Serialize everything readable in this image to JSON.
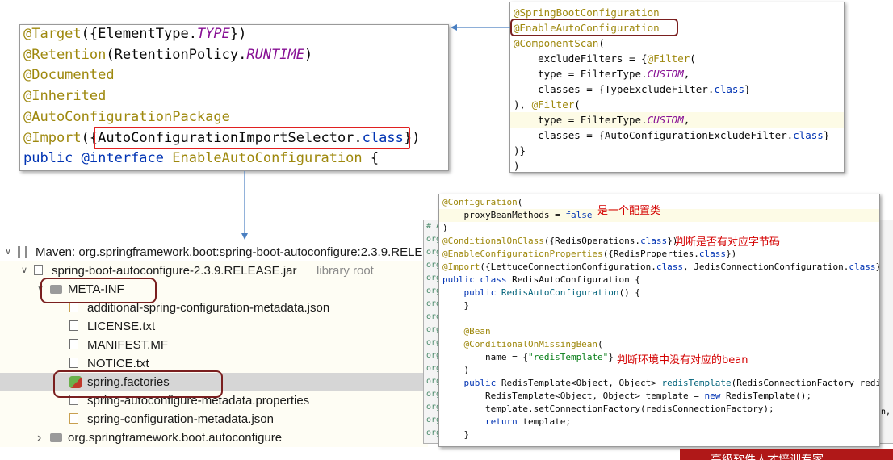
{
  "panel1": {
    "lines": [
      [
        {
          "t": "@Target",
          "c": "ann"
        },
        {
          "t": "({ElementType.",
          "c": "plain"
        },
        {
          "t": "TYPE",
          "c": "it"
        },
        {
          "t": "})",
          "c": "plain"
        }
      ],
      [
        {
          "t": "@Retention",
          "c": "ann"
        },
        {
          "t": "(RetentionPolicy.",
          "c": "plain"
        },
        {
          "t": "RUNTIME",
          "c": "it"
        },
        {
          "t": ")",
          "c": "plain"
        }
      ],
      [
        {
          "t": "@Documented",
          "c": "ann"
        }
      ],
      [
        {
          "t": "@Inherited",
          "c": "ann"
        }
      ],
      [
        {
          "t": "@AutoConfigurationPackage",
          "c": "ann"
        }
      ],
      [
        {
          "t": "@Import",
          "c": "ann"
        },
        {
          "t": "({",
          "c": "plain"
        },
        {
          "t": "AutoConfigurationImportSelector.",
          "c": "plain"
        },
        {
          "t": "class",
          "c": "kw"
        },
        {
          "t": "})",
          "c": "plain"
        }
      ],
      [
        {
          "t": "public ",
          "c": "kw"
        },
        {
          "t": "@interface ",
          "c": "kw"
        },
        {
          "t": "EnableAutoConfiguration",
          "c": "ann"
        },
        {
          "t": " {",
          "c": "plain"
        }
      ]
    ]
  },
  "panel2": {
    "lines": [
      [
        {
          "t": "@SpringBootConfiguration",
          "c": "ann"
        }
      ],
      [
        {
          "t": "@EnableAutoConfiguration",
          "c": "ann"
        }
      ],
      [
        {
          "t": "@ComponentScan",
          "c": "ann"
        },
        {
          "t": "(",
          "c": "plain"
        }
      ],
      [
        {
          "t": "    excludeFilters = {",
          "c": "plain"
        },
        {
          "t": "@Filter",
          "c": "ann"
        },
        {
          "t": "(",
          "c": "plain"
        }
      ],
      [
        {
          "t": "    type = FilterType.",
          "c": "plain"
        },
        {
          "t": "CUSTOM",
          "c": "it"
        },
        {
          "t": ",",
          "c": "plain"
        }
      ],
      [
        {
          "t": "    classes = {TypeExcludeFilter.",
          "c": "plain"
        },
        {
          "t": "class",
          "c": "kw"
        },
        {
          "t": "}",
          "c": "plain"
        }
      ],
      [
        {
          "t": "), ",
          "c": "plain"
        },
        {
          "t": "@Filter",
          "c": "ann"
        },
        {
          "t": "(",
          "c": "plain"
        }
      ],
      [
        {
          "t": "    type = FilterType.",
          "c": "plain"
        },
        {
          "t": "CUSTOM",
          "c": "it"
        },
        {
          "t": ",",
          "c": "plain"
        }
      ],
      [
        {
          "t": "    classes = {AutoConfigurationExcludeFilter.",
          "c": "plain"
        },
        {
          "t": "class",
          "c": "kw"
        },
        {
          "t": "}",
          "c": "plain"
        }
      ],
      [
        {
          "t": ")}",
          "c": "plain"
        }
      ],
      [
        {
          "t": ")",
          "c": "plain"
        }
      ]
    ]
  },
  "tree": {
    "rows": [
      {
        "text": "Maven: org.springframework.boot:spring-boot-autoconfigure:2.3.9.RELE",
        "suffix": "",
        "icon": "library-icon",
        "chevron": "open"
      },
      {
        "text": "spring-boot-autoconfigure-2.3.9.RELEASE.jar",
        "suffix": "library root",
        "icon": "jar-icon",
        "chevron": "open"
      },
      {
        "text": "META-INF",
        "suffix": "",
        "icon": "folder-icon",
        "chevron": "open"
      },
      {
        "text": "additional-spring-configuration-metadata.json",
        "suffix": "",
        "icon": "json-file-icon",
        "chevron": ""
      },
      {
        "text": "LICENSE.txt",
        "suffix": "",
        "icon": "text-file-icon",
        "chevron": ""
      },
      {
        "text": "MANIFEST.MF",
        "suffix": "",
        "icon": "manifest-file-icon",
        "chevron": ""
      },
      {
        "text": "NOTICE.txt",
        "suffix": "",
        "icon": "text-file-icon",
        "chevron": ""
      },
      {
        "text": "spring.factories",
        "suffix": "",
        "icon": "spring-file-icon",
        "chevron": ""
      },
      {
        "text": "spring-autoconfigure-metadata.properties",
        "suffix": "",
        "icon": "properties-file-icon",
        "chevron": ""
      },
      {
        "text": "spring-configuration-metadata.json",
        "suffix": "",
        "icon": "json-file-icon",
        "chevron": ""
      },
      {
        "text": "org.springframework.boot.autoconfigure",
        "suffix": "",
        "icon": "package-icon",
        "chevron": "closed"
      }
    ]
  },
  "panel3": {
    "back_gutter": [
      "# A",
      "org",
      "org",
      "org",
      "org",
      "org",
      "org",
      "org",
      "org",
      "org",
      "org",
      "org",
      "org",
      "org",
      "org",
      "org",
      "org"
    ],
    "back_right": "n,",
    "lines": [
      [
        {
          "t": "@Configuration",
          "c": "ann"
        },
        {
          "t": "(",
          "c": "plain"
        }
      ],
      [
        {
          "t": "    proxyBeanMethods = ",
          "c": "plain"
        },
        {
          "t": "false",
          "c": "kw"
        }
      ],
      [
        {
          "t": ")",
          "c": "plain"
        }
      ],
      [
        {
          "t": "@ConditionalOnClass",
          "c": "ann"
        },
        {
          "t": "({RedisOperations.",
          "c": "plain"
        },
        {
          "t": "class",
          "c": "kw"
        },
        {
          "t": "})",
          "c": "plain"
        }
      ],
      [
        {
          "t": "@EnableConfigurationProperties",
          "c": "ann"
        },
        {
          "t": "({RedisProperties.",
          "c": "plain"
        },
        {
          "t": "class",
          "c": "kw"
        },
        {
          "t": "})",
          "c": "plain"
        }
      ],
      [
        {
          "t": "@Import",
          "c": "ann"
        },
        {
          "t": "({LettuceConnectionConfiguration.",
          "c": "plain"
        },
        {
          "t": "class",
          "c": "kw"
        },
        {
          "t": ", JedisConnectionConfiguration.",
          "c": "plain"
        },
        {
          "t": "class",
          "c": "kw"
        },
        {
          "t": "})",
          "c": "plain"
        }
      ],
      [
        {
          "t": "public class ",
          "c": "kw"
        },
        {
          "t": "RedisAutoConfiguration {",
          "c": "plain"
        }
      ],
      [
        {
          "t": "    public ",
          "c": "kw"
        },
        {
          "t": "RedisAutoConfiguration",
          "c": "fn"
        },
        {
          "t": "() {",
          "c": "plain"
        }
      ],
      [
        {
          "t": "    }",
          "c": "plain"
        }
      ],
      [
        {
          "t": "",
          "c": "plain"
        }
      ],
      [
        {
          "t": "    @Bean",
          "c": "ann"
        }
      ],
      [
        {
          "t": "    @ConditionalOnMissingBean",
          "c": "ann"
        },
        {
          "t": "(",
          "c": "plain"
        }
      ],
      [
        {
          "t": "        name = {",
          "c": "plain"
        },
        {
          "t": "\"redisTemplate\"",
          "c": "str"
        },
        {
          "t": "}",
          "c": "plain"
        }
      ],
      [
        {
          "t": "    )",
          "c": "plain"
        }
      ],
      [
        {
          "t": "    public ",
          "c": "kw"
        },
        {
          "t": "RedisTemplate<Object, Object> ",
          "c": "plain"
        },
        {
          "t": "redisTemplate",
          "c": "fn"
        },
        {
          "t": "(RedisConnectionFactory redisCo",
          "c": "plain"
        }
      ],
      [
        {
          "t": "        RedisTemplate<Object, Object> template = ",
          "c": "plain"
        },
        {
          "t": "new ",
          "c": "kw"
        },
        {
          "t": "RedisTemplate();",
          "c": "plain"
        }
      ],
      [
        {
          "t": "        template.setConnectionFactory(redisConnectionFactory);",
          "c": "plain"
        }
      ],
      [
        {
          "t": "        ",
          "c": "plain"
        },
        {
          "t": "return ",
          "c": "kw"
        },
        {
          "t": "template;",
          "c": "plain"
        }
      ],
      [
        {
          "t": "    }",
          "c": "plain"
        }
      ]
    ]
  },
  "notes": {
    "config_class": "是一个配置类",
    "check_bytecode": "判断是否有对应字节码",
    "check_bean": "判断环境中没有对应的bean"
  },
  "banner": "高级软件人才培训专家",
  "colors": {
    "annotation": "#9e880d",
    "keyword": "#0033b3",
    "italic_const": "#871094",
    "highlight_box": "#e02020",
    "round_box": "#7a1f1f",
    "arrow": "#4a7fc1",
    "note": "#d40000"
  }
}
